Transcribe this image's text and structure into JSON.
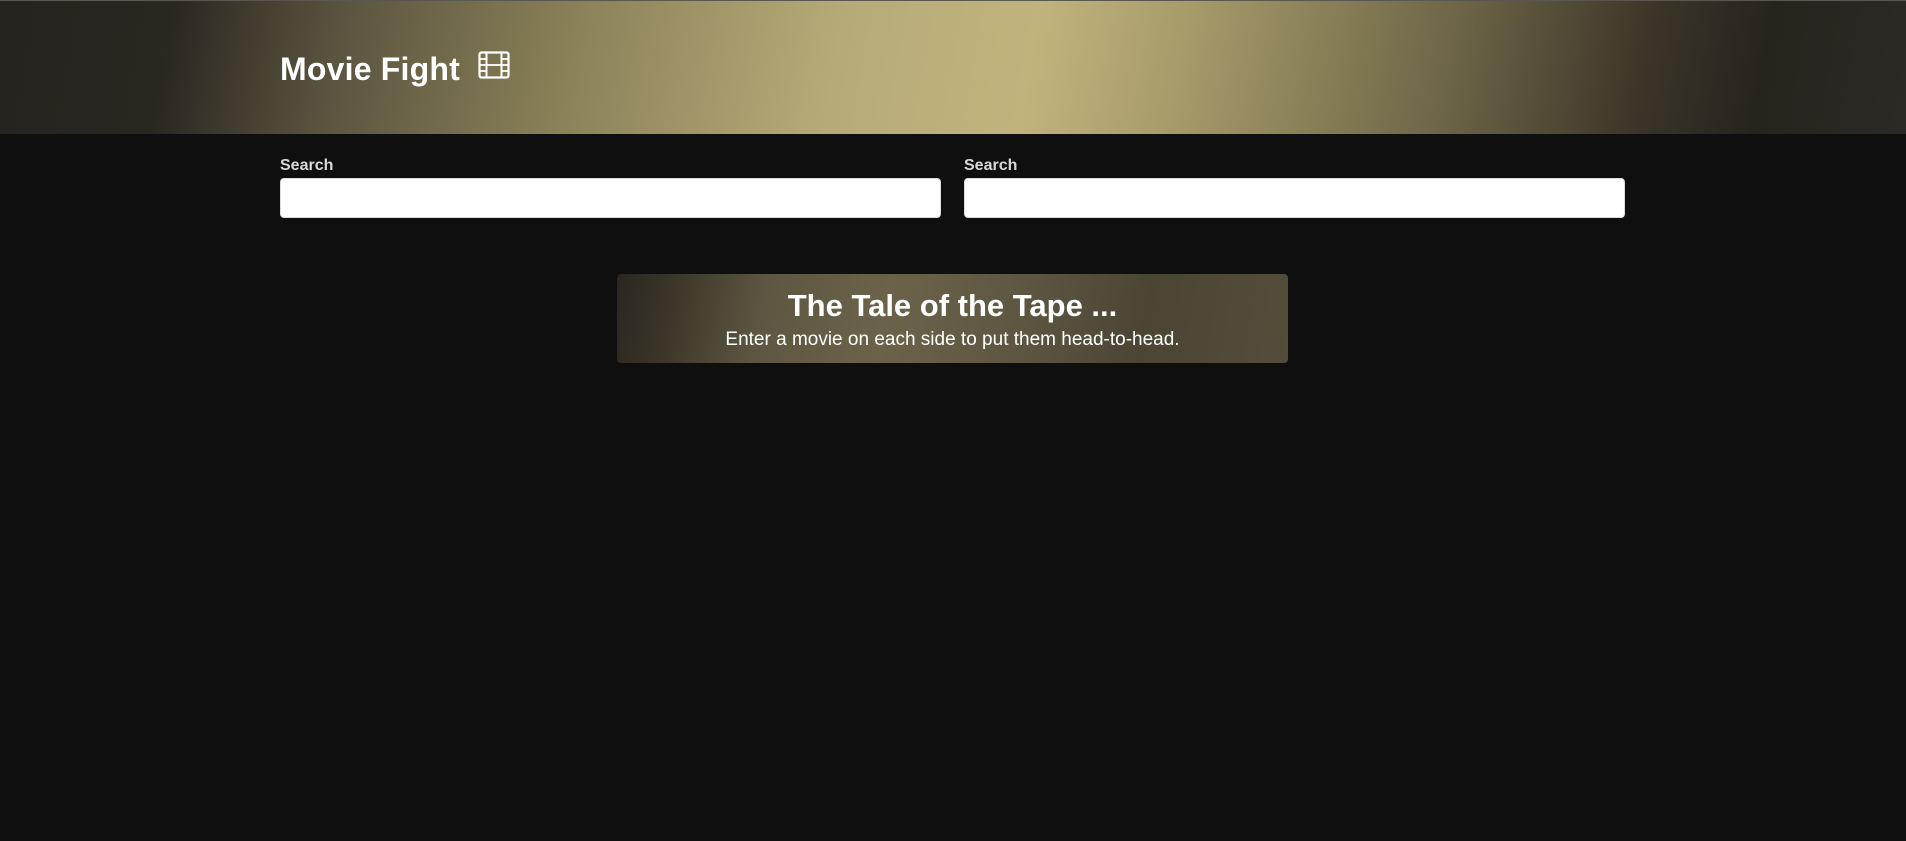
{
  "header": {
    "title": "Movie Fight",
    "icon": "film-icon"
  },
  "search": {
    "left": {
      "label": "Search",
      "value": "",
      "placeholder": ""
    },
    "right": {
      "label": "Search",
      "value": "",
      "placeholder": ""
    }
  },
  "tape": {
    "title": "The Tale of the Tape ...",
    "subtitle": "Enter a movie on each side to put them head-to-head."
  },
  "colors": {
    "background": "#0f0f0f",
    "hero_accent": "#c1b37c",
    "hero_dark": "#26241f",
    "text": "#ffffff"
  }
}
